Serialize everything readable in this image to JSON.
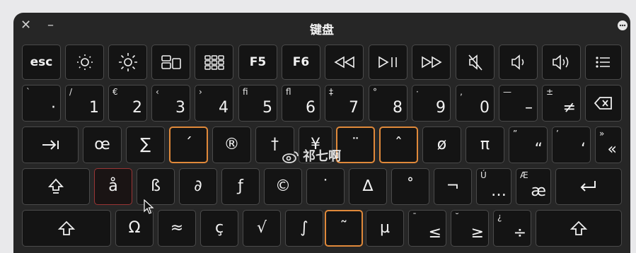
{
  "window": {
    "title": "键盘"
  },
  "row1": [
    "esc",
    "F5",
    "F6"
  ],
  "row2": {
    "backtick": {
      "sub": "`",
      "main": "·"
    },
    "k1": {
      "sub": "/",
      "main": "1"
    },
    "k2": {
      "sub": "€",
      "main": "2"
    },
    "k3": {
      "sub": "‹",
      "main": "3"
    },
    "k4": {
      "sub": "›",
      "main": "4"
    },
    "k5": {
      "sub": "fi",
      "main": "5"
    },
    "k6": {
      "sub": "fl",
      "main": "6"
    },
    "k7": {
      "sub": "‡",
      "main": "7"
    },
    "k8": {
      "sub": "°",
      "main": "8"
    },
    "k9": {
      "sub": "·",
      "main": "9"
    },
    "k0": {
      "sub": "‚",
      "main": "0"
    },
    "minus": {
      "sub": "—",
      "main": "–"
    },
    "equal": {
      "sub": "±",
      "main": "≠"
    }
  },
  "row3": {
    "oe": "œ",
    "sigma": "∑",
    "acute": "´",
    "reg": "®",
    "dagger": "†",
    "yen": "¥",
    "umlaut": "¨",
    "circ": "ˆ",
    "oslash": "ø",
    "pi": "π",
    "bracket_l": {
      "sub": "”",
      "main": "“"
    },
    "bracket_r": {
      "sub": "’",
      "main": "‘"
    },
    "backslash": {
      "sub": "»",
      "main": "«"
    }
  },
  "row4": {
    "a": "å",
    "s": "ß",
    "d": "∂",
    "f": "ƒ",
    "g": "©",
    "h": "˙",
    "j": "∆",
    "k": "˚",
    "l": "¬",
    "semicolon": {
      "sub": "Ú",
      "main": "…"
    },
    "quote": {
      "sub": "Æ",
      "main": "æ"
    }
  },
  "row5": {
    "z": "Ω",
    "x": "≈",
    "c": "ç",
    "v": "√",
    "b": "∫",
    "n": "˜",
    "m": "µ",
    "comma": {
      "sub": "¯",
      "main": "≤"
    },
    "period": {
      "sub": "˘",
      "main": "≥"
    },
    "slash": {
      "sub": "¿",
      "main": "÷"
    }
  },
  "watermark": "祁七啊",
  "colors": {
    "window_bg": "#262626",
    "key_bg": "#141414",
    "highlight": "#e0893a",
    "pressed": "#9a3535"
  }
}
